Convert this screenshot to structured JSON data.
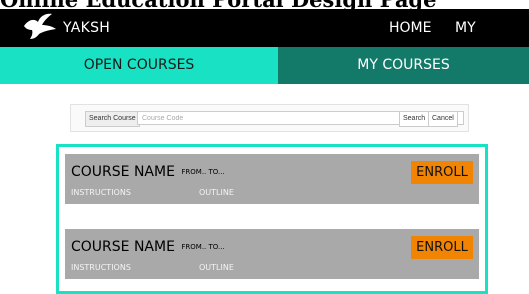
{
  "page_heading": "Online Education Portal Design Page",
  "navbar": {
    "brand": "YAKSH",
    "home_label": "HOME",
    "profile_label": "MY PROFILE"
  },
  "tabs": [
    {
      "label": "OPEN COURSES",
      "active": true
    },
    {
      "label": "MY COURSES",
      "active": false
    }
  ],
  "search": {
    "label": "Search Course",
    "placeholder": "Course Code",
    "value": "",
    "search_label": "Search",
    "cancel_label": "Cancel"
  },
  "courses": [
    {
      "name": "COURSE NAME",
      "dates": "FROM.. TO...",
      "instructions_label": "INSTRUCTIONS",
      "outline_label": "OUTLINE",
      "enroll_label": "ENROLL"
    },
    {
      "name": "COURSE NAME",
      "dates": "FROM.. TO...",
      "instructions_label": "INSTRUCTIONS",
      "outline_label": "OUTLINE",
      "enroll_label": "ENROLL"
    }
  ],
  "colors": {
    "navbar_bg": "#000000",
    "tab_active": "#18e2c3",
    "tab_inactive": "#137a69",
    "card_bg": "#a9a9a9",
    "enroll_bg": "#f18403"
  },
  "icons": {
    "logo": "bird-logo-icon"
  }
}
